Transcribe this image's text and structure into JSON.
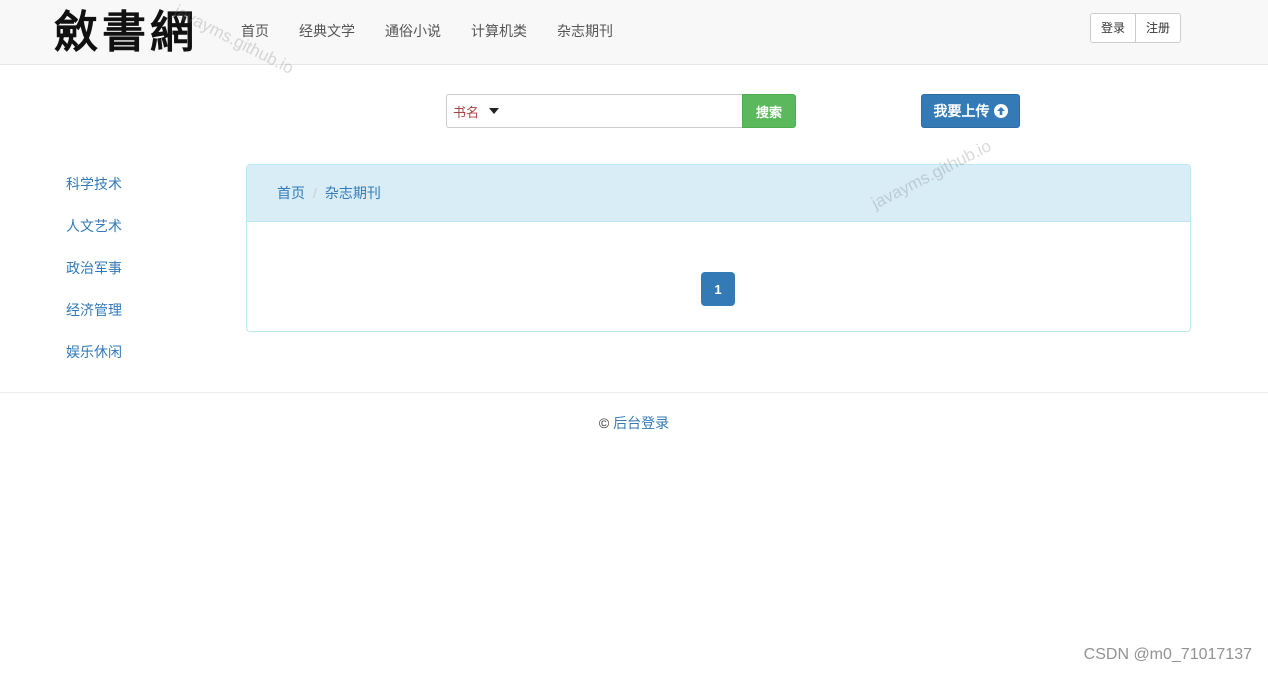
{
  "brand": {
    "title": "斂書網"
  },
  "nav": {
    "links": [
      "首页",
      "经典文学",
      "通俗小说",
      "计算机类",
      "杂志期刊"
    ]
  },
  "auth": {
    "login": "登录",
    "register": "注册"
  },
  "search": {
    "type_selected": "书名",
    "query": "",
    "button": "搜索"
  },
  "upload": {
    "label": "我要上传"
  },
  "sidebar": {
    "items": [
      "科学技术",
      "人文艺术",
      "政治军事",
      "经济管理",
      "娱乐休闲"
    ]
  },
  "breadcrumb": {
    "home": "首页",
    "current": "杂志期刊"
  },
  "pagination": {
    "current_page": "1"
  },
  "footer": {
    "copyright": "©",
    "admin_link": "后台登录"
  },
  "watermarks": {
    "text": "javayms.github.io",
    "csdn": "CSDN @m0_71017137"
  },
  "colors": {
    "primary": "#337ab7",
    "success": "#5cb85c",
    "panel_heading": "#d9edf7",
    "navbar": "#f8f8f8"
  }
}
